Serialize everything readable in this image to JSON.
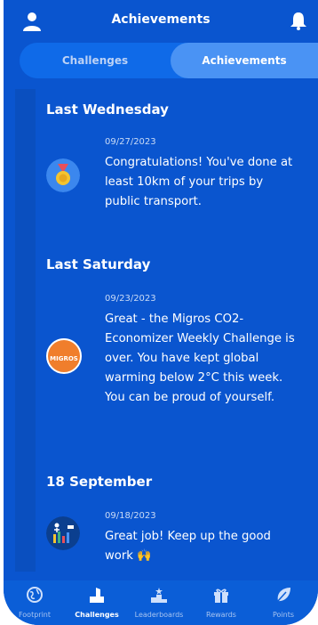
{
  "header": {
    "title": "Achievements"
  },
  "tabs": [
    {
      "label": "Challenges"
    },
    {
      "label": "Achievements"
    }
  ],
  "groups": [
    {
      "title": "Last Wednesday",
      "entry": {
        "date": "09/27/2023",
        "message": "Congratulations! You've done at least 10km of your trips by public transport.",
        "icon": "medal-icon"
      }
    },
    {
      "title": "Last Saturday",
      "entry": {
        "date": "09/23/2023",
        "message": "Great - the Migros CO2-Economizer Weekly Challenge is over. You have kept global warming below 2°C this week. You can be proud of yourself.",
        "icon": "migros-logo",
        "logo_text": "MIGROS"
      }
    },
    {
      "title": "18 September",
      "entry": {
        "date": "09/18/2023",
        "message": "Great job! Keep up the good work 🙌",
        "icon": "community-icon"
      }
    }
  ],
  "bottom_nav": [
    {
      "label": "Footprint",
      "icon": "globe-icon"
    },
    {
      "label": "Challenges",
      "icon": "challenges-icon"
    },
    {
      "label": "Leaderboards",
      "icon": "podium-icon"
    },
    {
      "label": "Rewards",
      "icon": "gift-icon"
    },
    {
      "label": "Points",
      "icon": "leaf-icon"
    }
  ],
  "colors": {
    "background": "#0a55cf",
    "active_tab": "#4a93f4",
    "migros": "#f07e2c"
  }
}
